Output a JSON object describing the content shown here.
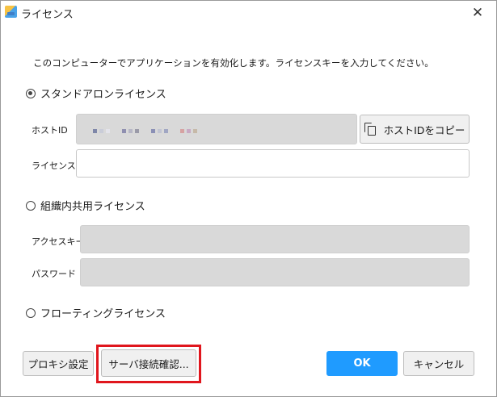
{
  "window": {
    "title": "ライセンス",
    "close_glyph": "✕"
  },
  "description": "このコンピューターでアプリケーションを有効化します。ライセンスキーを入力してください。",
  "standalone": {
    "radio_label": "スタンドアロンライセンス",
    "selected": true,
    "host_id_label": "ホストID",
    "copy_button_label": "ホストIDをコピー",
    "license_label": "ライセンス",
    "license_value": ""
  },
  "org_shared": {
    "radio_label": "組織内共用ライセンス",
    "selected": false,
    "access_key_label": "アクセスキー",
    "access_key_value": "",
    "password_label": "パスワード",
    "password_value": ""
  },
  "floating": {
    "radio_label": "フローティングライセンス",
    "selected": false
  },
  "footer": {
    "proxy_button_label": "プロキシ設定",
    "server_check_button_label": "サーバ接続確認...",
    "ok_button_label": "OK",
    "cancel_button_label": "キャンセル"
  },
  "colors": {
    "accent": "#1f9bff",
    "highlight": "#e0161d",
    "disabled_field": "#d9d9d9"
  },
  "icons": {
    "app": "app-icon",
    "close": "close-icon",
    "copy": "copy-icon"
  }
}
